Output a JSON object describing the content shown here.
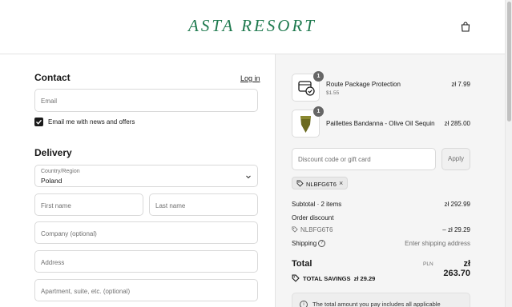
{
  "header": {
    "logo": "ASTA RESORT",
    "cart_icon": "shopping-bag-icon"
  },
  "contact": {
    "title": "Contact",
    "login_link": "Log in",
    "email_placeholder": "Email",
    "newsletter_label": "Email me with news and offers",
    "newsletter_checked": true
  },
  "delivery": {
    "title": "Delivery",
    "country_label": "Country/Region",
    "country_value": "Poland",
    "first_name_placeholder": "First name",
    "last_name_placeholder": "Last name",
    "company_placeholder": "Company (optional)",
    "address_placeholder": "Address",
    "apartment_placeholder": "Apartment, suite, etc. (optional)"
  },
  "summary": {
    "items": [
      {
        "name": "Route Package Protection",
        "sub": "$1.55",
        "price": "zł 7.99",
        "qty": "1",
        "icon": "package-check-icon"
      },
      {
        "name": "Paillettes Bandanna - Olive Oil Sequin",
        "sub": "",
        "price": "zł 285.00",
        "qty": "1",
        "icon": "bandanna-image"
      }
    ],
    "discount_placeholder": "Discount code or gift card",
    "apply_label": "Apply",
    "applied_code": "NLBFG6T6",
    "subtotal_label": "Subtotal · 2 items",
    "subtotal_value": "zł 292.99",
    "order_discount_label": "Order discount",
    "order_discount_code": "NLBFG6T6",
    "order_discount_value": "– zł 29.29",
    "shipping_label": "Shipping",
    "shipping_value": "Enter shipping address",
    "total_label": "Total",
    "currency": "PLN",
    "total_value": "zł 263.70",
    "savings_label": "TOTAL SAVINGS",
    "savings_value": "zł 29.29",
    "info_text": "The total amount you pay includes all applicable"
  },
  "colors": {
    "brand": "#1f7a4f",
    "summary_bg": "#f5f5f5"
  }
}
